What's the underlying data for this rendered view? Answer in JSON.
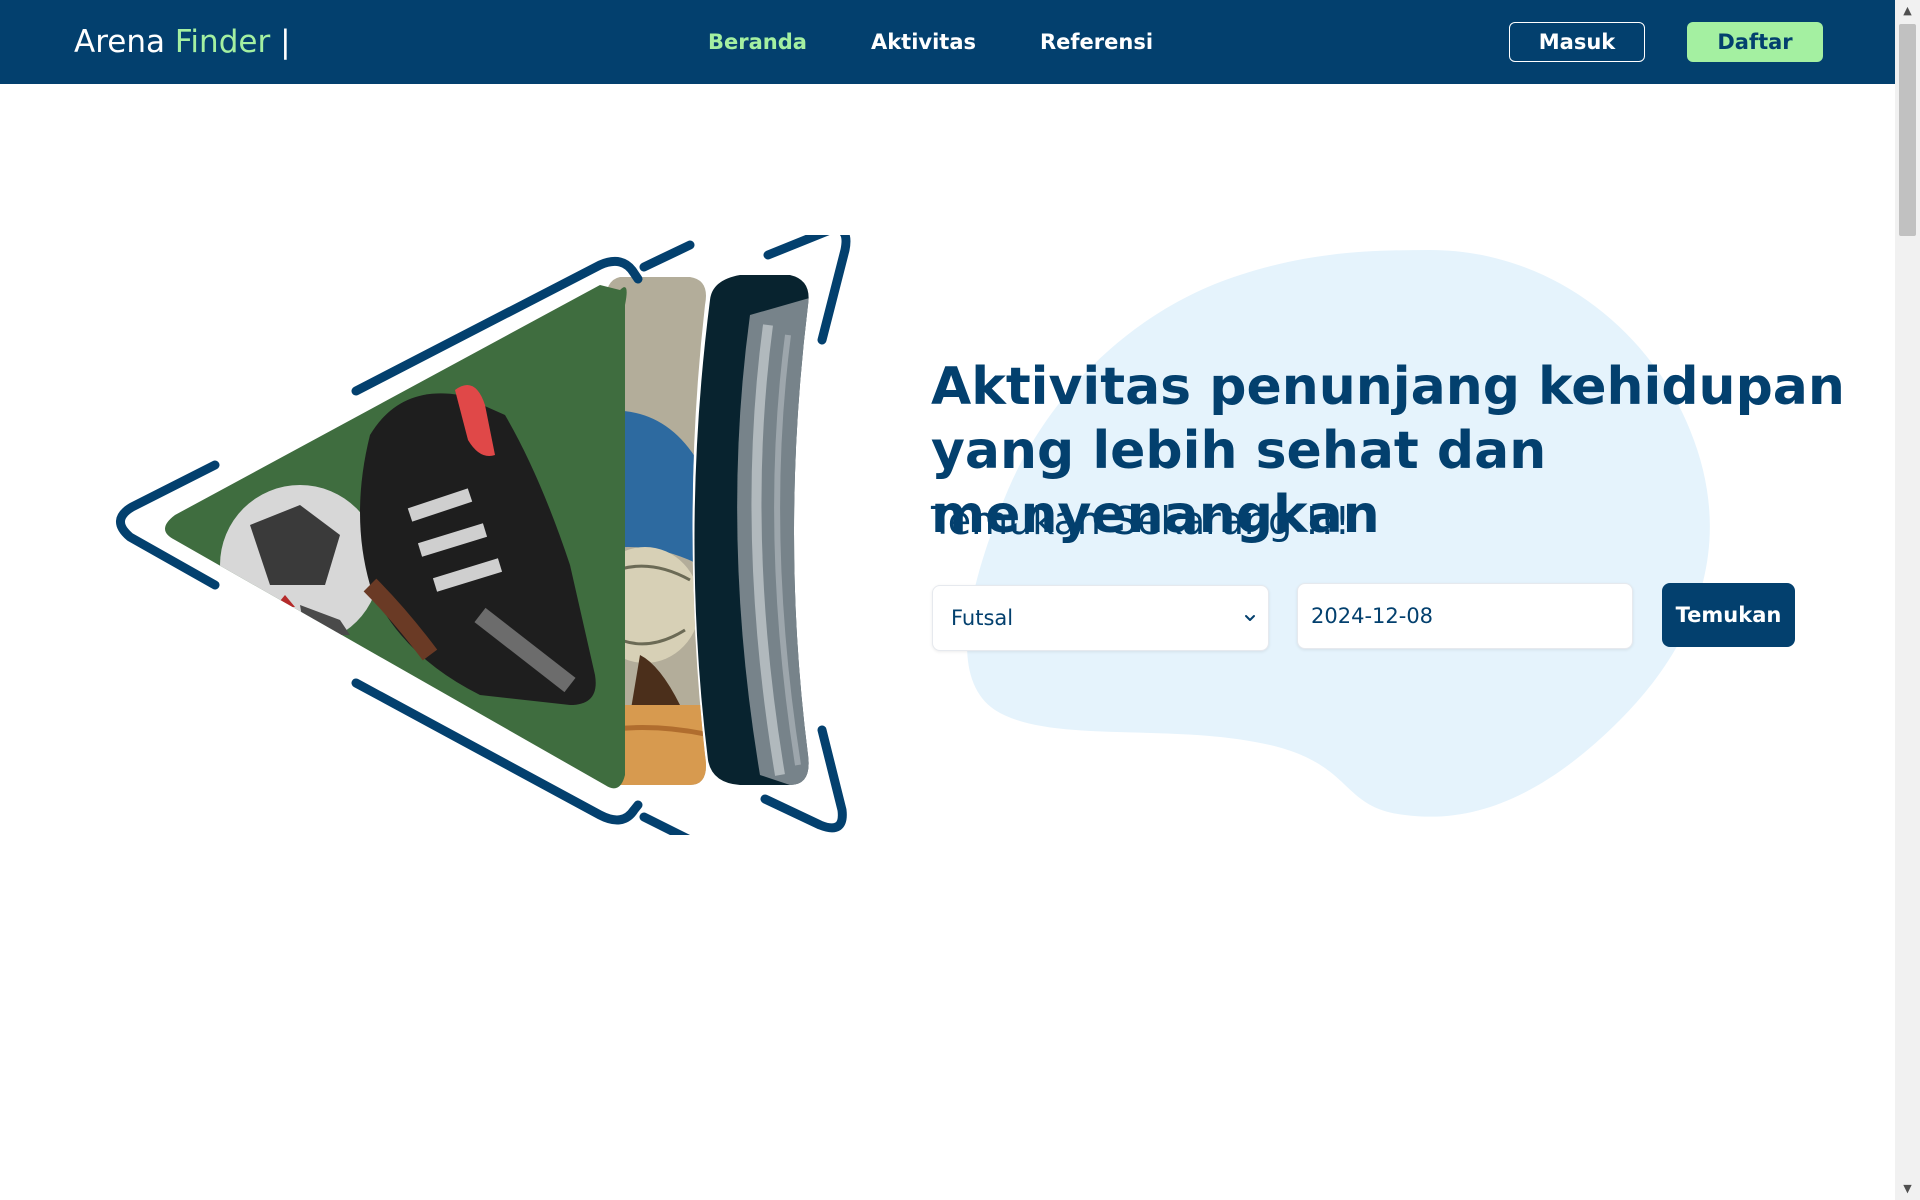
{
  "header": {
    "brand_main": "Arena",
    "brand_accent": "Finder",
    "brand_cursor": "|",
    "nav": [
      {
        "label": "Beranda",
        "active": true
      },
      {
        "label": "Aktivitas",
        "active": false
      },
      {
        "label": "Referensi",
        "active": false
      }
    ],
    "login_label": "Masuk",
    "register_label": "Daftar"
  },
  "hero": {
    "title": "Aktivitas penunjang kehidupan yang lebih sehat dan menyenangkan",
    "subtitle": "Temukan Sekarang !!!",
    "search": {
      "sport_selected": "Futsal",
      "date_value": "2024-12-08",
      "submit_label": "Temukan"
    },
    "image_icon": "sports-collage-image"
  },
  "colors": {
    "primary": "#03406e",
    "accent": "#a4f0a1",
    "blob": "#e5f3fc",
    "background": "#ffffff"
  }
}
